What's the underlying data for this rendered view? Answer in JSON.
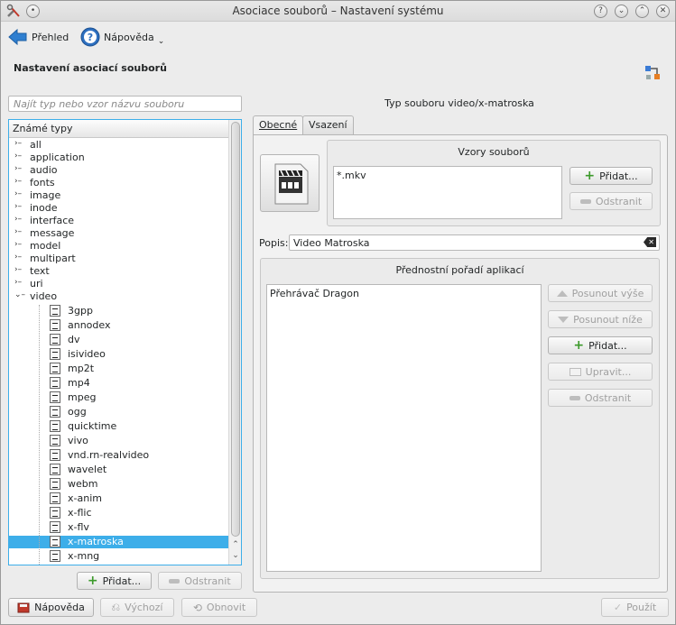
{
  "window": {
    "title": "Asociace souborů – Nastavení systému",
    "title_buttons": [
      "?",
      "⌄",
      "⌃",
      "✕"
    ]
  },
  "toolbar": {
    "overview_label": "Přehled",
    "help_label": "Nápověda"
  },
  "page_title": "Nastavení asociací souborů",
  "search": {
    "placeholder": "Najít typ nebo vzor názvu souboru"
  },
  "tree": {
    "header": "Známé typy",
    "groups": [
      "all",
      "application",
      "audio",
      "fonts",
      "image",
      "inode",
      "interface",
      "message",
      "model",
      "multipart",
      "text",
      "uri",
      "video"
    ],
    "video_children": [
      "3gpp",
      "annodex",
      "dv",
      "isivideo",
      "mp2t",
      "mp4",
      "mpeg",
      "ogg",
      "quicktime",
      "vivo",
      "vnd.rn-realvideo",
      "wavelet",
      "webm",
      "x-anim",
      "x-flic",
      "x-flv",
      "x-matroska",
      "x-mng"
    ],
    "selected": "x-matroska"
  },
  "left_buttons": {
    "add": "Přidat...",
    "remove": "Odstranit"
  },
  "type_title": "Typ souboru video/x-matroska",
  "tabs": [
    "Obecné",
    "Vsazení"
  ],
  "patterns": {
    "title": "Vzory souborů",
    "items": [
      "*.mkv"
    ],
    "add": "Přidat...",
    "remove": "Odstranit"
  },
  "description": {
    "label": "Popis:",
    "value": "Video Matroska"
  },
  "apps": {
    "title": "Přednostní pořadí aplikací",
    "items": [
      "Přehrávač Dragon"
    ],
    "move_up": "Posunout výše",
    "move_down": "Posunout níže",
    "add": "Přidat...",
    "edit": "Upravit...",
    "remove": "Odstranit"
  },
  "footer": {
    "help": "Nápověda",
    "defaults": "Výchozí",
    "reset": "Obnovit",
    "apply": "Použít"
  },
  "colors": {
    "selection": "#3daee9",
    "plus": "#3c9a2b"
  }
}
